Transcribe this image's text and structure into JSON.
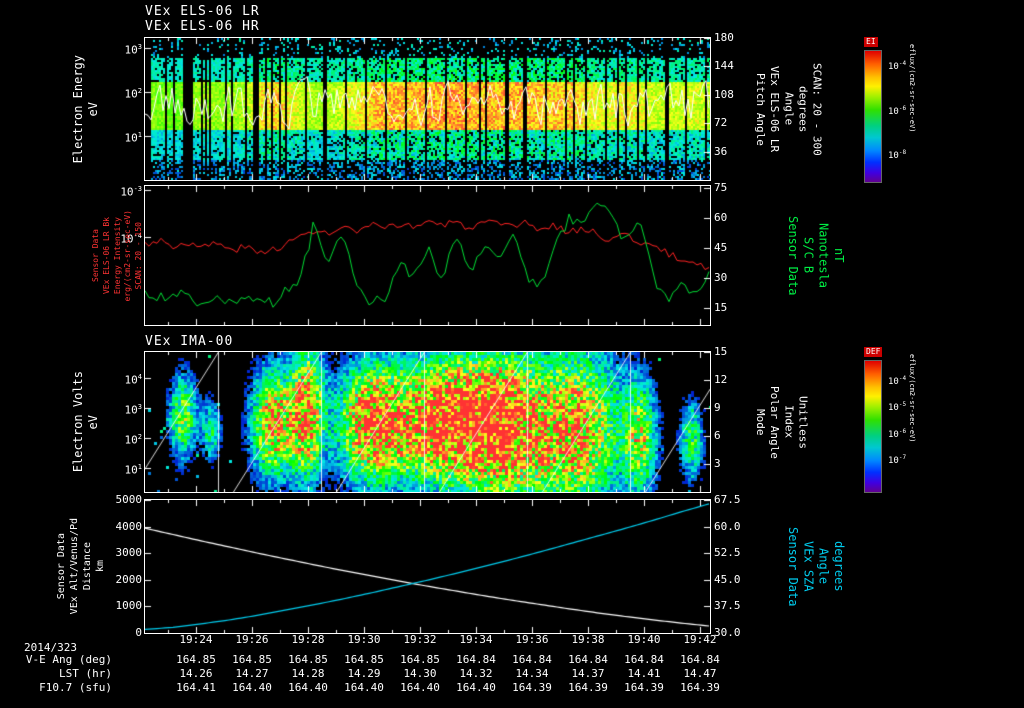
{
  "app": {
    "background": "#000000"
  },
  "titles": {
    "panel1_line1": "VEx ELS-06 LR",
    "panel1_line2": "VEx ELS-06 HR",
    "panel3": "VEx IMA-00"
  },
  "time_axis": {
    "date_label": "2014/323",
    "tick_labels": [
      "19:24",
      "19:26",
      "19:28",
      "19:30",
      "19:32",
      "19:34",
      "19:36",
      "19:38",
      "19:40",
      "19:42"
    ]
  },
  "table": {
    "rows": [
      {
        "label": "V-E Ang (deg)",
        "values": [
          "164.85",
          "164.85",
          "164.85",
          "164.85",
          "164.85",
          "164.84",
          "164.84",
          "164.84",
          "164.84",
          "164.84"
        ]
      },
      {
        "label": "LST (hr)",
        "values": [
          "14.26",
          "14.27",
          "14.28",
          "14.29",
          "14.30",
          "14.32",
          "14.34",
          "14.37",
          "14.41",
          "14.47"
        ]
      },
      {
        "label": "F10.7 (sfu)",
        "values": [
          "164.41",
          "164.40",
          "164.40",
          "164.40",
          "164.40",
          "164.40",
          "164.39",
          "164.39",
          "164.39",
          "164.39"
        ]
      }
    ]
  },
  "chart_data": [
    {
      "id": "els_energy_spectrogram",
      "type": "heatmap",
      "title": "VEx ELS-06 LR / VEx ELS-06 HR",
      "description": "Electron energy-time spectrogram with white trace overlay; rainbow color scale on black",
      "left_axis": {
        "label_lines": [
          "Electron Energy",
          "eV"
        ],
        "ticks": [
          {
            "label": "10^3",
            "pos": 0.07
          },
          {
            "label": "10^2",
            "pos": 0.38
          },
          {
            "label": "10^1",
            "pos": 0.69
          }
        ]
      },
      "right_axis": {
        "label_lines": [
          "Pitch Angle",
          "VEx ELS-06 LR",
          "Angle",
          "degrees",
          "SCAN: 20 - 300"
        ],
        "ticks": [
          {
            "label": "180",
            "pos": 0.0
          },
          {
            "label": "144",
            "pos": 0.2
          },
          {
            "label": "108",
            "pos": 0.4
          },
          {
            "label": "72",
            "pos": 0.6
          },
          {
            "label": "36",
            "pos": 0.8
          }
        ]
      },
      "colorbar": {
        "title": "EI",
        "units": "eflux/(cm2-sr-sec-eV)",
        "ticks": [
          {
            "label": "10^-4",
            "pos": 0.167
          },
          {
            "label": "10^-6",
            "pos": 0.5
          },
          {
            "label": "10^-8",
            "pos": 0.833
          }
        ]
      },
      "intensity_profile": [
        0.45,
        0.4,
        0.35,
        0.45,
        0.5,
        0.45,
        0.5,
        0.55,
        0.75,
        0.85,
        0.7,
        0.55,
        0.5,
        0.55,
        0.65,
        0.75,
        0.9,
        0.95,
        0.9,
        0.92,
        0.95,
        1.0,
        0.97,
        0.95,
        0.9,
        0.95,
        0.92,
        0.88,
        0.85,
        0.9,
        0.8,
        0.7,
        0.65,
        0.75,
        0.7,
        0.6,
        0.55,
        0.6,
        0.65,
        0.55
      ],
      "seed": 7
    },
    {
      "id": "intensity_and_bfield",
      "type": "line",
      "left_axis": {
        "color": "#ff3333",
        "label_lines": [
          "Sensor Data",
          "VEx ELS-06 LR Bk",
          "Energy Intensity",
          "erg/(cm2-sr-sec-eV)",
          "SCAN: 20 - 150"
        ],
        "ticks": [
          {
            "label": "10^-3",
            "pos": 0.029
          },
          {
            "label": "10^-4",
            "pos": 0.367
          }
        ]
      },
      "right_axis": {
        "color": "#00ee44",
        "label_lines": [
          "Sensor Data",
          "S/C B",
          "Nanotesla",
          "nT"
        ],
        "ticks": [
          {
            "label": "75",
            "pos": 0.014
          },
          {
            "label": "60",
            "pos": 0.23
          },
          {
            "label": "45",
            "pos": 0.446
          },
          {
            "label": "30",
            "pos": 0.662
          },
          {
            "label": "15",
            "pos": 0.878
          }
        ]
      },
      "series": [
        {
          "name": "VEx ELS-06 LR Bk Energy Intensity",
          "axis": "left",
          "scale": "log",
          "units": "erg/(cm2-sr-sec-eV)",
          "color": "#ff2222",
          "log10_values": [
            -4.15,
            -4.05,
            -4.2,
            -4.1,
            -4.25,
            -4.1,
            -4.3,
            -4.2,
            -4.35,
            -4.25,
            -4.15,
            -4.0,
            -3.85,
            -3.95,
            -3.8,
            -3.9,
            -3.75,
            -3.85,
            -3.7,
            -3.8,
            -3.65,
            -3.75,
            -3.7,
            -3.8,
            -3.7,
            -3.75,
            -3.8,
            -3.7,
            -3.85,
            -3.75,
            -3.9,
            -3.8,
            -3.95,
            -4.05,
            -3.95,
            -4.1,
            -4.2,
            -4.35,
            -4.5,
            -4.55,
            -4.65
          ]
        },
        {
          "name": "S/C B",
          "axis": "right",
          "units": "nT",
          "color": "#00dd33",
          "values": [
            22,
            19,
            24,
            20,
            18,
            22,
            19,
            17,
            21,
            18,
            23,
            30,
            58,
            38,
            52,
            24,
            17,
            20,
            38,
            30,
            45,
            27,
            52,
            33,
            45,
            38,
            55,
            30,
            26,
            45,
            60,
            55,
            70,
            62,
            48,
            57,
            30,
            20,
            26,
            22,
            35
          ]
        }
      ]
    },
    {
      "id": "ima_spectrogram",
      "type": "heatmap",
      "title": "VEx IMA-00",
      "description": "Ion energy-time spectrogram, blobs of flux with white energy-sweep sawtooth lines",
      "left_axis": {
        "label_lines": [
          "Electron Volts",
          "eV"
        ],
        "ticks": [
          {
            "label": "10^4",
            "pos": 0.186
          },
          {
            "label": "10^3",
            "pos": 0.4
          },
          {
            "label": "10^2",
            "pos": 0.614
          },
          {
            "label": "10^1",
            "pos": 0.829
          }
        ]
      },
      "right_axis": {
        "label_lines": [
          "Mode",
          "Polar Angle",
          "Index",
          "Unitless"
        ],
        "ticks": [
          {
            "label": "15",
            "pos": 0.0
          },
          {
            "label": "12",
            "pos": 0.2
          },
          {
            "label": "9",
            "pos": 0.4
          },
          {
            "label": "6",
            "pos": 0.6
          },
          {
            "label": "3",
            "pos": 0.8
          }
        ]
      },
      "colorbar": {
        "title": "DEF",
        "units": "eflux/(cm2-sr-sec-eV)",
        "ticks": [
          {
            "label": "10^-4",
            "pos": 0.2
          },
          {
            "label": "10^-5",
            "pos": 0.4
          },
          {
            "label": "10^-6",
            "pos": 0.6
          },
          {
            "label": "10^-7",
            "pos": 0.8
          }
        ]
      },
      "blobs": [
        {
          "x": 0.065,
          "y": 0.45,
          "rx": 0.018,
          "ry": 0.22,
          "amp": 0.6
        },
        {
          "x": 0.115,
          "y": 0.55,
          "rx": 0.012,
          "ry": 0.15,
          "amp": 0.45
        },
        {
          "x": 0.225,
          "y": 0.5,
          "rx": 0.028,
          "ry": 0.28,
          "amp": 0.85
        },
        {
          "x": 0.285,
          "y": 0.42,
          "rx": 0.02,
          "ry": 0.33,
          "amp": 0.9
        },
        {
          "x": 0.4,
          "y": 0.5,
          "rx": 0.045,
          "ry": 0.3,
          "amp": 1.0
        },
        {
          "x": 0.525,
          "y": 0.48,
          "rx": 0.055,
          "ry": 0.33,
          "amp": 1.0
        },
        {
          "x": 0.63,
          "y": 0.52,
          "rx": 0.05,
          "ry": 0.38,
          "amp": 0.95
        },
        {
          "x": 0.76,
          "y": 0.55,
          "rx": 0.06,
          "ry": 0.42,
          "amp": 0.85
        },
        {
          "x": 0.875,
          "y": 0.6,
          "rx": 0.02,
          "ry": 0.28,
          "amp": 0.6
        },
        {
          "x": 0.965,
          "y": 0.62,
          "rx": 0.015,
          "ry": 0.2,
          "amp": 0.5
        }
      ],
      "seed": 11
    },
    {
      "id": "altitude_and_sza",
      "type": "line",
      "left_axis": {
        "label_lines": [
          "Sensor Data",
          "VEx Alt/Venus/Pd",
          "Distance",
          "km"
        ],
        "range": [
          0,
          5000
        ],
        "ticks": [
          {
            "label": "5000",
            "pos": 0.0
          },
          {
            "label": "4000",
            "pos": 0.2
          },
          {
            "label": "3000",
            "pos": 0.4
          },
          {
            "label": "2000",
            "pos": 0.6
          },
          {
            "label": "1000",
            "pos": 0.8
          },
          {
            "label": "0",
            "pos": 1.0
          }
        ]
      },
      "right_axis": {
        "color": "#00ccee",
        "label_lines": [
          "Sensor Data",
          "VEx SZA",
          "Angle",
          "degrees"
        ],
        "range": [
          30,
          67.5
        ],
        "ticks": [
          {
            "label": "67.5",
            "pos": 0.0
          },
          {
            "label": "60.0",
            "pos": 0.2
          },
          {
            "label": "52.5",
            "pos": 0.4
          },
          {
            "label": "45.0",
            "pos": 0.6
          },
          {
            "label": "37.5",
            "pos": 0.8
          },
          {
            "label": "30.0",
            "pos": 1.0
          }
        ]
      },
      "series": [
        {
          "name": "VEx Alt/Venus/Pd Distance",
          "axis": "left",
          "units": "km",
          "color": "#ffffff",
          "values": [
            3940,
            3700,
            3460,
            3230,
            3000,
            2780,
            2560,
            2350,
            2150,
            1950,
            1760,
            1580,
            1400,
            1230,
            1070,
            910,
            760,
            620,
            490,
            370,
            260
          ]
        },
        {
          "name": "VEx SZA Angle",
          "axis": "right",
          "units": "degrees",
          "color": "#00ccee",
          "values": [
            31.0,
            31.6,
            32.6,
            33.7,
            35.0,
            36.5,
            38.0,
            39.6,
            41.3,
            43.1,
            44.9,
            46.8,
            48.8,
            50.8,
            52.9,
            55.1,
            57.3,
            59.5,
            61.8,
            64.2,
            66.5
          ]
        }
      ]
    }
  ]
}
